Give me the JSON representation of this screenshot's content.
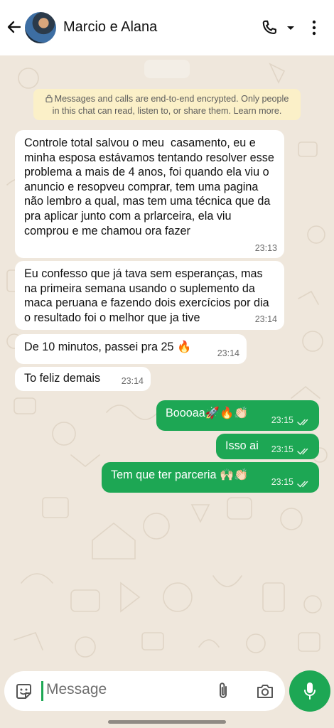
{
  "header": {
    "title": "Marcio e Alana"
  },
  "notice": {
    "text": "Messages and calls are end-to-end encrypted. Only people in this chat can read, listen to, or share them. Learn more."
  },
  "messages": [
    {
      "direction": "incoming",
      "text": "Controle total salvou o meu  casamento, eu e minha esposa estávamos tentando resolver esse problema a mais de 4 anos, foi quando ela viu o anuncio e resopveu comprar, tem uma pagina não lembro a qual, mas tem uma técnica que da pra aplicar junto com a prlarceira, ela viu comprou e me chamou ora fazer",
      "time": "23:13"
    },
    {
      "direction": "incoming",
      "text": "Eu confesso que já tava sem esperanças, mas na primeira semana usando o suplemento da maca peruana e fazendo dois exercícios por dia o resultado foi o melhor que ja tive",
      "time": "23:14"
    },
    {
      "direction": "incoming",
      "text": "De 10 minutos, passei pra 25 🔥",
      "time": "23:14"
    },
    {
      "direction": "incoming",
      "text": "To feliz demais",
      "time": "23:14"
    },
    {
      "direction": "outgoing",
      "text": "Boooaa🚀🔥👏🏻",
      "time": "23:15"
    },
    {
      "direction": "outgoing",
      "text": "Isso ai",
      "time": "23:15"
    },
    {
      "direction": "outgoing",
      "text": "Tem que ter parceria 🙌🏻👏🏻",
      "time": "23:15"
    }
  ],
  "input": {
    "placeholder": "Message"
  },
  "colors": {
    "accent": "#1da754",
    "background": "#efe7dc",
    "notice": "#fbf0c8"
  },
  "icons": [
    "back-arrow-icon",
    "phone-icon",
    "dropdown-caret-icon",
    "more-vert-icon",
    "lock-icon",
    "emoji-icon",
    "attach-icon",
    "camera-icon",
    "mic-icon",
    "read-receipt-icon"
  ]
}
